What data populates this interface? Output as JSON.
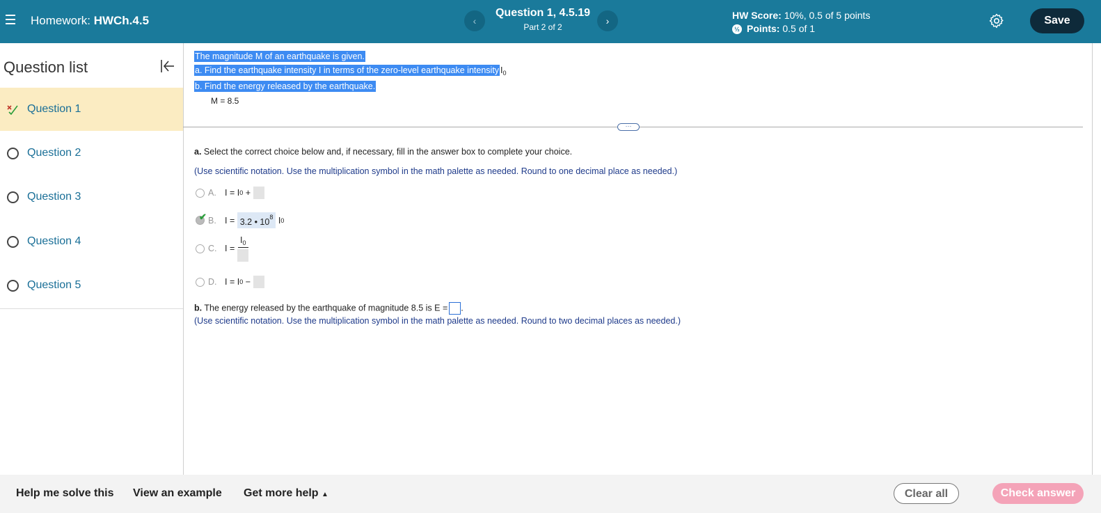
{
  "header": {
    "hw_prefix": "Homework:",
    "hw_name": "HWCh.4.5",
    "question_title": "Question 1, 4.5.19",
    "part": "Part 2 of 2",
    "prev_icon": "‹",
    "next_icon": "›",
    "score_label": "HW Score:",
    "score_value": "10%, 0.5 of 5 points",
    "points_label": "Points:",
    "points_value": "0.5 of 1",
    "save_label": "Save",
    "bar_color": "#1a7a9b"
  },
  "sidebar": {
    "title": "Question list",
    "items": [
      {
        "label": "Question 1",
        "status": "partial"
      },
      {
        "label": "Question 2",
        "status": "none"
      },
      {
        "label": "Question 3",
        "status": "none"
      },
      {
        "label": "Question 4",
        "status": "none"
      },
      {
        "label": "Question 5",
        "status": "none"
      }
    ]
  },
  "problem": {
    "line1": "The magnitude M of an earthquake is given.",
    "line2_a": "a. Find the earthquake intensity I in terms of the zero-level earthquake intensity",
    "line3": "b. Find the energy released by the earthquake.",
    "m_value": "M = 8.5",
    "more": "···"
  },
  "part_a": {
    "prefix": "a.",
    "instruction": "Select the correct choice below and, if necessary, fill in the answer box to complete your choice.",
    "note": "(Use scientific notation. Use the multiplication symbol in the math palette as needed. Round to one decimal place as needed.)",
    "choices": {
      "a": {
        "letter": "A.",
        "expr": "I = I",
        "op": "+"
      },
      "b": {
        "letter": "B.",
        "expr": "I =",
        "mantissa": "3.2 • 10",
        "exponent": "8",
        "tail": "I",
        "selected": true
      },
      "c": {
        "letter": "C.",
        "expr": "I ="
      },
      "d": {
        "letter": "D.",
        "expr": "I = I",
        "op": "−"
      }
    }
  },
  "part_b": {
    "prefix": "b.",
    "text": "The energy released by the earthquake of magnitude 8.5 is E =",
    "note": "(Use scientific notation. Use the multiplication symbol in the math palette as needed. Round to two decimal places as needed.)"
  },
  "footer": {
    "help": "Help me solve this",
    "example": "View an example",
    "more_help": "Get more help",
    "clear": "Clear all",
    "check": "Check answer"
  }
}
